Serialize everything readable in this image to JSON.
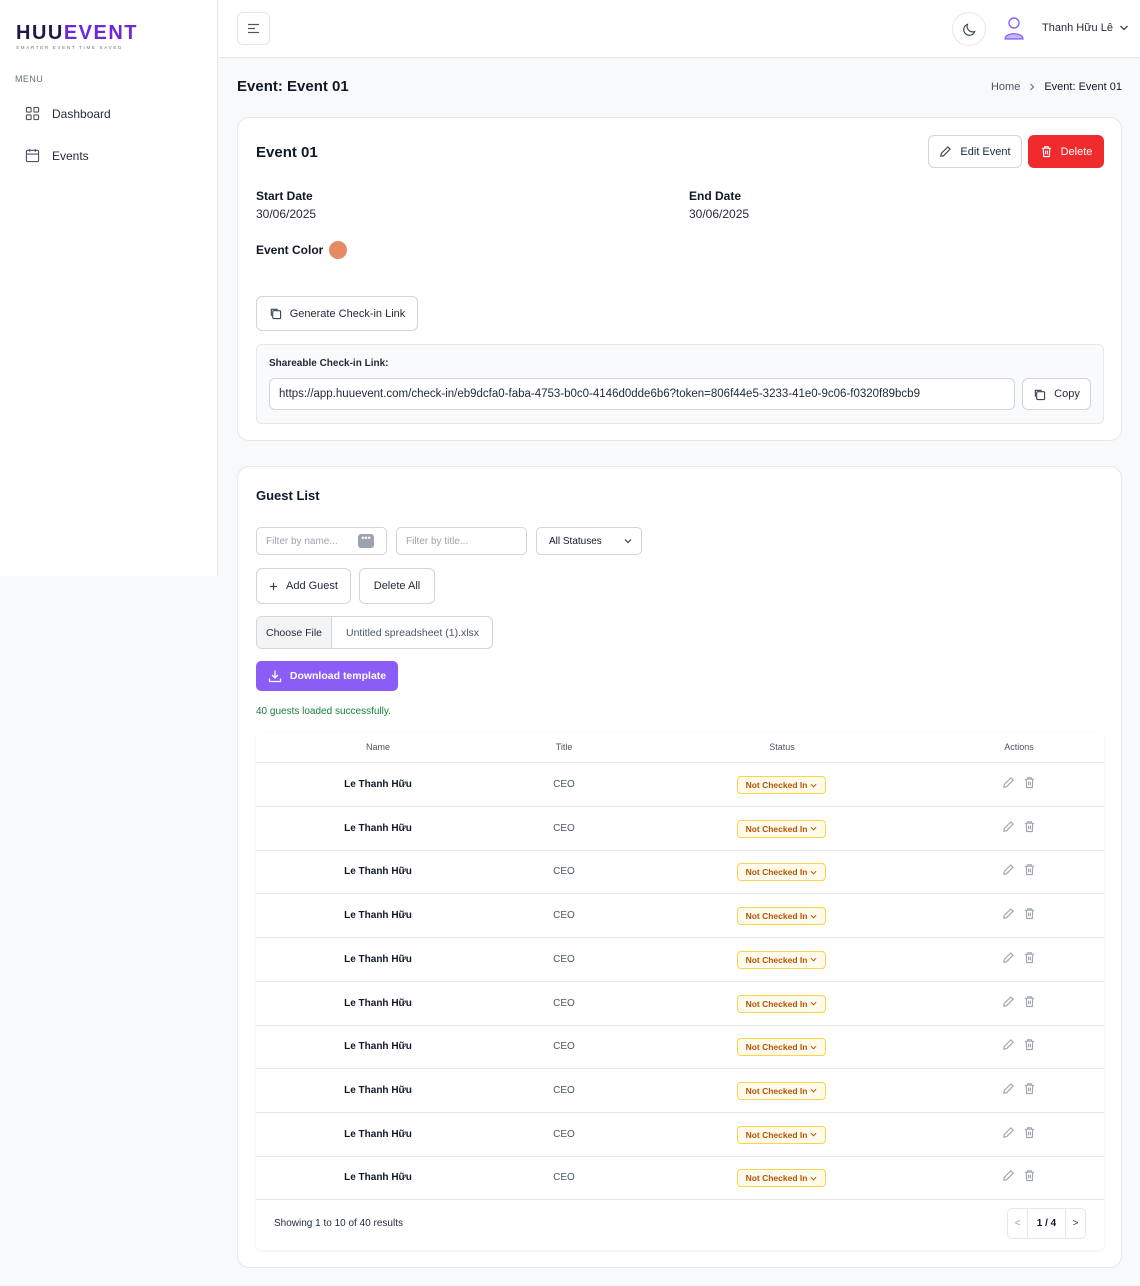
{
  "brand": {
    "name_dark": "HUU",
    "name_accent": "EVENT",
    "tagline": "SMARTER EVENT TIME SAVED",
    "accent_color": "#6d28d9"
  },
  "sidebar": {
    "menu_title": "MENU",
    "items": [
      {
        "label": "Dashboard",
        "icon": "grid-icon"
      },
      {
        "label": "Events",
        "icon": "calendar-icon"
      }
    ]
  },
  "topbar": {
    "user_name": "Thanh Hữu Lê"
  },
  "page": {
    "title": "Event: Event 01",
    "breadcrumb": [
      "Home",
      "Event: Event 01"
    ]
  },
  "event": {
    "name": "Event 01",
    "edit_label": "Edit Event",
    "delete_label": "Delete",
    "start_label": "Start Date",
    "start_value": "30/06/2025",
    "end_label": "End Date",
    "end_value": "30/06/2025",
    "color_label": "Event Color",
    "color": "#e58a63",
    "generate_label": "Generate Check-in Link",
    "share_label": "Shareable Check-in Link:",
    "share_link": "https://app.huuevent.com/check-in/eb9dcfa0-faba-4753-b0c0-4146d0dde6b6?token=806f44e5-3233-41e0-9c06-f0320f89bcb9",
    "copy_label": "Copy"
  },
  "guests": {
    "title": "Guest List",
    "filter_name_placeholder": "Filter by name...",
    "filter_title_placeholder": "Filter by title...",
    "status_filter": "All Statuses",
    "add_label": "Add Guest",
    "delete_all_label": "Delete All",
    "choose_file_label": "Choose File",
    "file_name": "Untitled spreadsheet (1).xlsx",
    "download_label": "Download template",
    "success_message": "40 guests loaded successfully.",
    "columns": [
      "Name",
      "Title",
      "Status",
      "Actions"
    ],
    "rows": [
      {
        "name": "Le Thanh Hữu",
        "title": "CEO",
        "status": "Not Checked In"
      },
      {
        "name": "Le Thanh Hữu",
        "title": "CEO",
        "status": "Not Checked In"
      },
      {
        "name": "Le Thanh Hữu",
        "title": "CEO",
        "status": "Not Checked In"
      },
      {
        "name": "Le Thanh Hữu",
        "title": "CEO",
        "status": "Not Checked In"
      },
      {
        "name": "Le Thanh Hữu",
        "title": "CEO",
        "status": "Not Checked In"
      },
      {
        "name": "Le Thanh Hữu",
        "title": "CEO",
        "status": "Not Checked In"
      },
      {
        "name": "Le Thanh Hữu",
        "title": "CEO",
        "status": "Not Checked In"
      },
      {
        "name": "Le Thanh Hữu",
        "title": "CEO",
        "status": "Not Checked In"
      },
      {
        "name": "Le Thanh Hữu",
        "title": "CEO",
        "status": "Not Checked In"
      },
      {
        "name": "Le Thanh Hữu",
        "title": "CEO",
        "status": "Not Checked In"
      }
    ],
    "showing": "Showing 1 to 10 of 40 results",
    "pager_prev": "<",
    "pager_current": "1 / 4",
    "pager_next": ">"
  }
}
